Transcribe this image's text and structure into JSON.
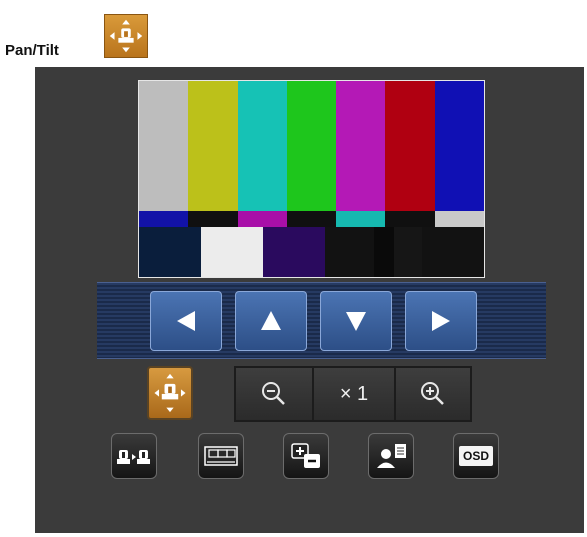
{
  "page": {
    "title": "Pan/Tilt"
  },
  "monitor": {
    "bar_colors": [
      "#bdbdbd",
      "#bcc11a",
      "#16c2b5",
      "#1ec61c",
      "#b419b6",
      "#b00011",
      "#1010b4"
    ],
    "castellation_colors": [
      "#1212a8",
      "#101010",
      "#a80fa8",
      "#101010",
      "#16b9b0",
      "#101010",
      "#c9c9c9"
    ],
    "pluge_colors": [
      "#0a1e3c",
      "#ececec",
      "#2a0a5e",
      "#121212",
      "#0a0a0a",
      "#161616",
      "#121212"
    ]
  },
  "controls": {
    "direction_buttons": [
      {
        "name": "pan-left-button",
        "icon": "arrow-left-icon"
      },
      {
        "name": "tilt-up-button",
        "icon": "arrow-up-icon"
      },
      {
        "name": "tilt-down-button",
        "icon": "arrow-down-icon"
      },
      {
        "name": "pan-right-button",
        "icon": "arrow-right-icon"
      }
    ],
    "zoom": {
      "value_label": "× 1",
      "zoom_out_icon": "zoom-out-icon",
      "zoom_in_icon": "zoom-in-icon"
    },
    "tools": [
      {
        "name": "preset-move-button",
        "icon": "preset-move-icon"
      },
      {
        "name": "preset-list-button",
        "icon": "preset-list-icon"
      },
      {
        "name": "plus-minus-button",
        "icon": "plus-minus-icon"
      },
      {
        "name": "user-settings-button",
        "icon": "user-icon"
      },
      {
        "name": "osd-button",
        "label": "OSD"
      }
    ]
  },
  "colors": {
    "accent_orange": "#c8862c",
    "ptz_blue": "#2d4f87",
    "panel_bg": "#3b3b3b"
  }
}
